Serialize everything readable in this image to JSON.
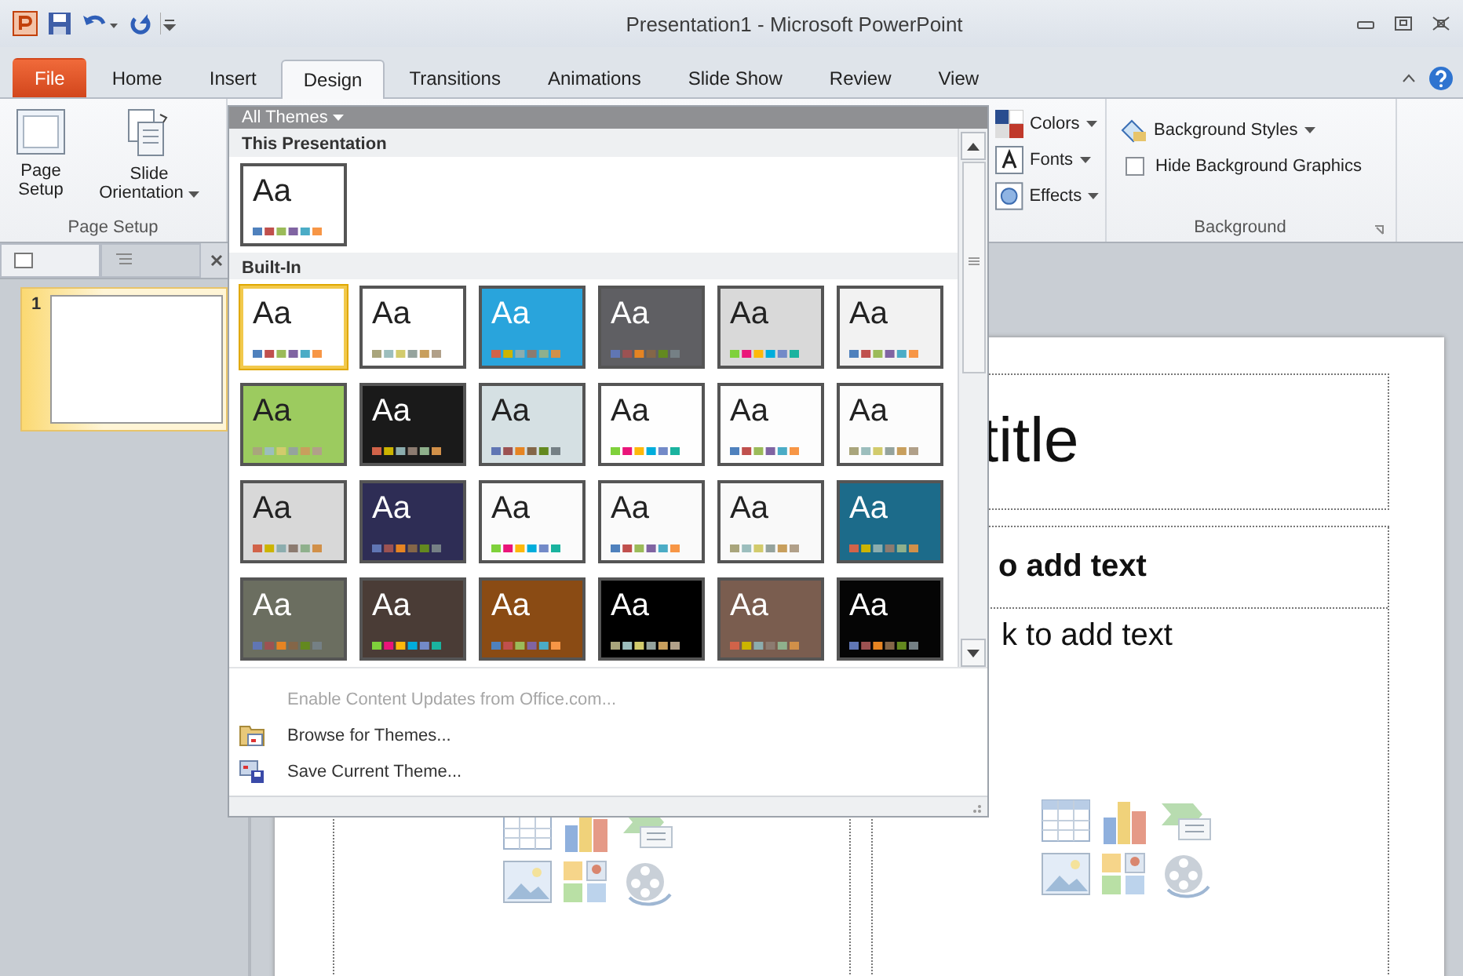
{
  "window": {
    "title": "Presentation1 - Microsoft PowerPoint"
  },
  "ribbon_tabs": [
    {
      "label": "File",
      "kind": "file",
      "selected": false
    },
    {
      "label": "Home",
      "kind": "tab",
      "selected": false
    },
    {
      "label": "Insert",
      "kind": "tab",
      "selected": false
    },
    {
      "label": "Design",
      "kind": "tab",
      "selected": true
    },
    {
      "label": "Transitions",
      "kind": "tab",
      "selected": false
    },
    {
      "label": "Animations",
      "kind": "tab",
      "selected": false
    },
    {
      "label": "Slide Show",
      "kind": "tab",
      "selected": false
    },
    {
      "label": "Review",
      "kind": "tab",
      "selected": false
    },
    {
      "label": "View",
      "kind": "tab",
      "selected": false
    }
  ],
  "page_setup": {
    "buttons": [
      {
        "label": "Page Setup",
        "kind": "setup"
      },
      {
        "label": "Slide Orientation",
        "kind": "orientation"
      }
    ],
    "group_label": "Page Setup"
  },
  "theme_options": [
    {
      "label": "Colors",
      "kind": "colors"
    },
    {
      "label": "Fonts",
      "kind": "fonts"
    },
    {
      "label": "Effects",
      "kind": "effects"
    }
  ],
  "background": {
    "styles_button": "Background Styles",
    "hide_graphics": {
      "label": "Hide Background Graphics",
      "checked": false
    },
    "group_label": "Background"
  },
  "gallery": {
    "filter": "All Themes",
    "this_presentation_header": "This Presentation",
    "this_presentation": [
      {
        "label": "Aa",
        "selected": false,
        "color": "#ffffff"
      }
    ],
    "built_in_header": "Built-In",
    "built_in": [
      {
        "label": "Aa",
        "selected": true,
        "color": "#ffffff"
      },
      {
        "label": "Aa",
        "selected": false,
        "color": "#ffffff"
      },
      {
        "label": "Aa",
        "selected": false,
        "color": "#29a4dc"
      },
      {
        "label": "Aa",
        "selected": false,
        "color": "#5f5f63"
      },
      {
        "label": "Aa",
        "selected": false,
        "color": "#d9d9d9"
      },
      {
        "label": "Aa",
        "selected": false,
        "color": "#f2f2f2"
      },
      {
        "label": "Aa",
        "selected": false,
        "color": "#9ccb5f"
      },
      {
        "label": "Aa",
        "selected": false,
        "color": "#1a1a1a"
      },
      {
        "label": "Aa",
        "selected": false,
        "color": "#d5e0e3"
      },
      {
        "label": "Aa",
        "selected": false,
        "color": "#fefefe"
      },
      {
        "label": "Aa",
        "selected": false,
        "color": "#fdfdfd"
      },
      {
        "label": "Aa",
        "selected": false,
        "color": "#fcfcfc"
      },
      {
        "label": "Aa",
        "selected": false,
        "color": "#d8d8d8"
      },
      {
        "label": "Aa",
        "selected": false,
        "color": "#2e2d55"
      },
      {
        "label": "Aa",
        "selected": false,
        "color": "#fbfbfb"
      },
      {
        "label": "Aa",
        "selected": false,
        "color": "#fafafa"
      },
      {
        "label": "Aa",
        "selected": false,
        "color": "#f9f9f9"
      },
      {
        "label": "Aa",
        "selected": false,
        "color": "#1c6b8a"
      },
      {
        "label": "Aa",
        "selected": false,
        "color": "#6b6e60"
      },
      {
        "label": "Aa",
        "selected": false,
        "color": "#4a3c36"
      },
      {
        "label": "Aa",
        "selected": false,
        "color": "#8a4b14"
      },
      {
        "label": "Aa",
        "selected": false,
        "color": "#000000"
      },
      {
        "label": "Aa",
        "selected": false,
        "color": "#7a5d4f"
      },
      {
        "label": "Aa",
        "selected": false,
        "color": "#050505"
      }
    ],
    "menu": [
      {
        "label": "Enable Content Updates from Office.com...",
        "kind": "none",
        "disabled": true
      },
      {
        "label": "Browse for Themes...",
        "kind": "browse",
        "disabled": false
      },
      {
        "label": "Save Current Theme...",
        "kind": "save",
        "disabled": false
      }
    ]
  },
  "slides_panel": {
    "slides": [
      {
        "number": "1",
        "selected": true
      }
    ]
  },
  "slide": {
    "title_fragment": "title",
    "heading_fragment": "o add text",
    "body_fragment": "k to add text"
  }
}
